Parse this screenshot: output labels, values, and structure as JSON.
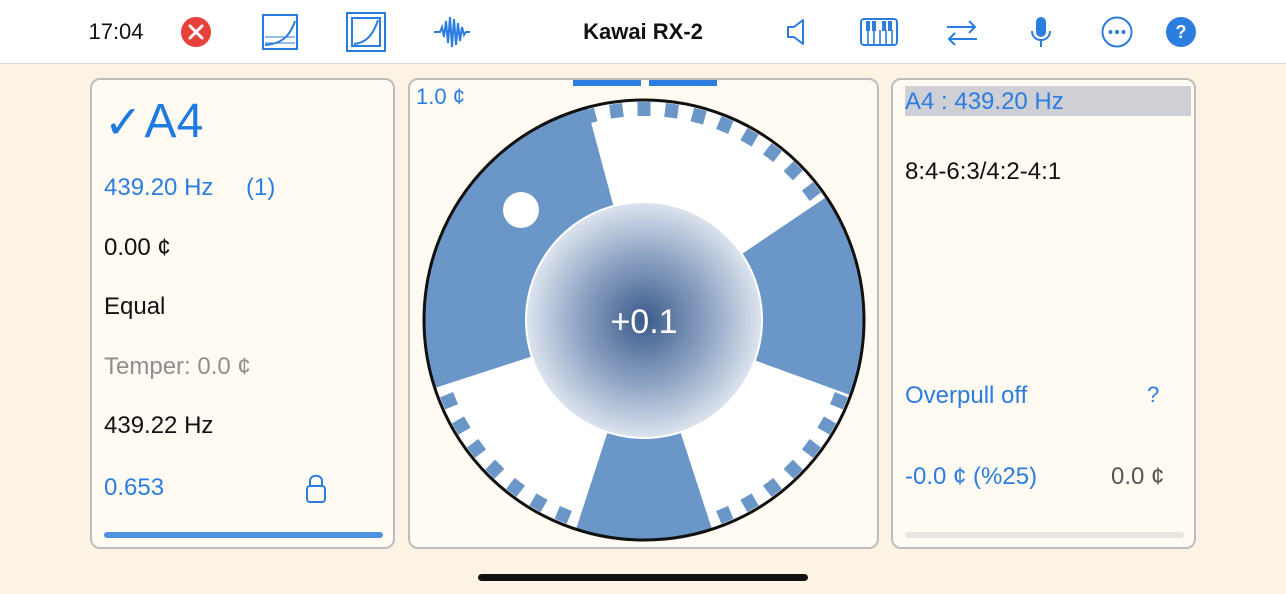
{
  "topbar": {
    "time": "17:04",
    "title": "Kawai RX-2",
    "icons": [
      "close-circle-icon",
      "curve-graph-icon",
      "curve-graph-framed-icon",
      "waveform-icon",
      "speaker-icon",
      "piano-keyboard-icon",
      "swap-arrows-icon",
      "microphone-icon",
      "more-ellipsis-icon",
      "help-icon"
    ],
    "colors": {
      "accent": "#2b7de0",
      "close": "#e8403a"
    }
  },
  "left": {
    "note": "A4",
    "frequency": "439.20 Hz",
    "count": "(1)",
    "cents": "0.00 ¢",
    "temperament": "Equal",
    "temper": "Temper: 0.0 ¢",
    "measured": "439.22 Hz",
    "value": "0.653"
  },
  "center": {
    "range": "1.0 ¢",
    "reading": "+0.1",
    "colors": {
      "segment": "#6b96c8",
      "ring": "#111111",
      "core": "#4a6a9a"
    }
  },
  "right": {
    "header": "A4 : 439.20 Hz",
    "ratio": "8:4-6:3/4:2-4:1",
    "overpull": "Overpull off",
    "help": "?",
    "overpull_value": "-0.0 ¢ (%25)",
    "offset": "0.0 ¢"
  }
}
